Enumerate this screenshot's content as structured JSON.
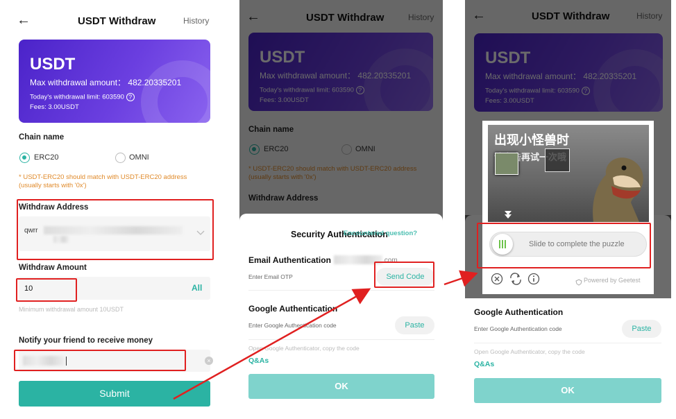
{
  "screen1": {
    "back_icon": "←",
    "title": "USDT Withdraw",
    "history": "History",
    "card": {
      "coin": "USDT",
      "max_label": "Max withdrawal amount：",
      "max_value": "482.20335201",
      "limit": "Today's withdrawal limit: 603590",
      "fees": "Fees: 3.00USDT"
    },
    "chain_label": "Chain name",
    "chain_options": [
      "ERC20",
      "OMNI"
    ],
    "chain_selected": "ERC20",
    "warning": "* USDT-ERC20 should match with USDT-ERC20 address (usually starts with '0x')",
    "address_label": "Withdraw Address",
    "address_value": "qwrr",
    "amount_label": "Withdraw Amount",
    "amount_value": "10",
    "all_label": "All",
    "min_hint": "Minimum withdrawal amount 10USDT",
    "notify_label": "Notify your friend to receive money",
    "submit": "Submit"
  },
  "screen2": {
    "sheet_title": "Security Authentication",
    "question_link": "Encountered question?",
    "email_title": "Email Authentication",
    "email_suffix": ".com",
    "email_placeholder": "Enter Email OTP",
    "send_code": "Send Code",
    "google_title": "Google Authentication",
    "google_placeholder": "Enter Google Authentication code",
    "paste": "Paste",
    "google_hint": "Open Google Authenticator, copy the code",
    "qa": "Q&As",
    "ok": "OK"
  },
  "screen3": {
    "captcha_text_1": "出现小怪兽时",
    "captcha_text_2": "请点击再试一次哦",
    "slider_text": "Slide to complete the puzzle",
    "powered": "Powered by Geetest",
    "google_title": "Google Authentication",
    "google_placeholder": "Enter Google Authentication code",
    "paste": "Paste",
    "google_hint": "Open Google Authenticator, copy the code",
    "qa": "Q&As",
    "ok": "OK"
  },
  "colors": {
    "accent": "#2bb3a3",
    "highlight": "#e02020",
    "card": "#5a30d8",
    "warning": "#e08a2a"
  },
  "icons": [
    "back-arrow-icon",
    "question-circle-icon",
    "chevron-down-icon",
    "clear-icon",
    "close-circle-icon",
    "refresh-icon",
    "info-icon",
    "shield-icon"
  ]
}
